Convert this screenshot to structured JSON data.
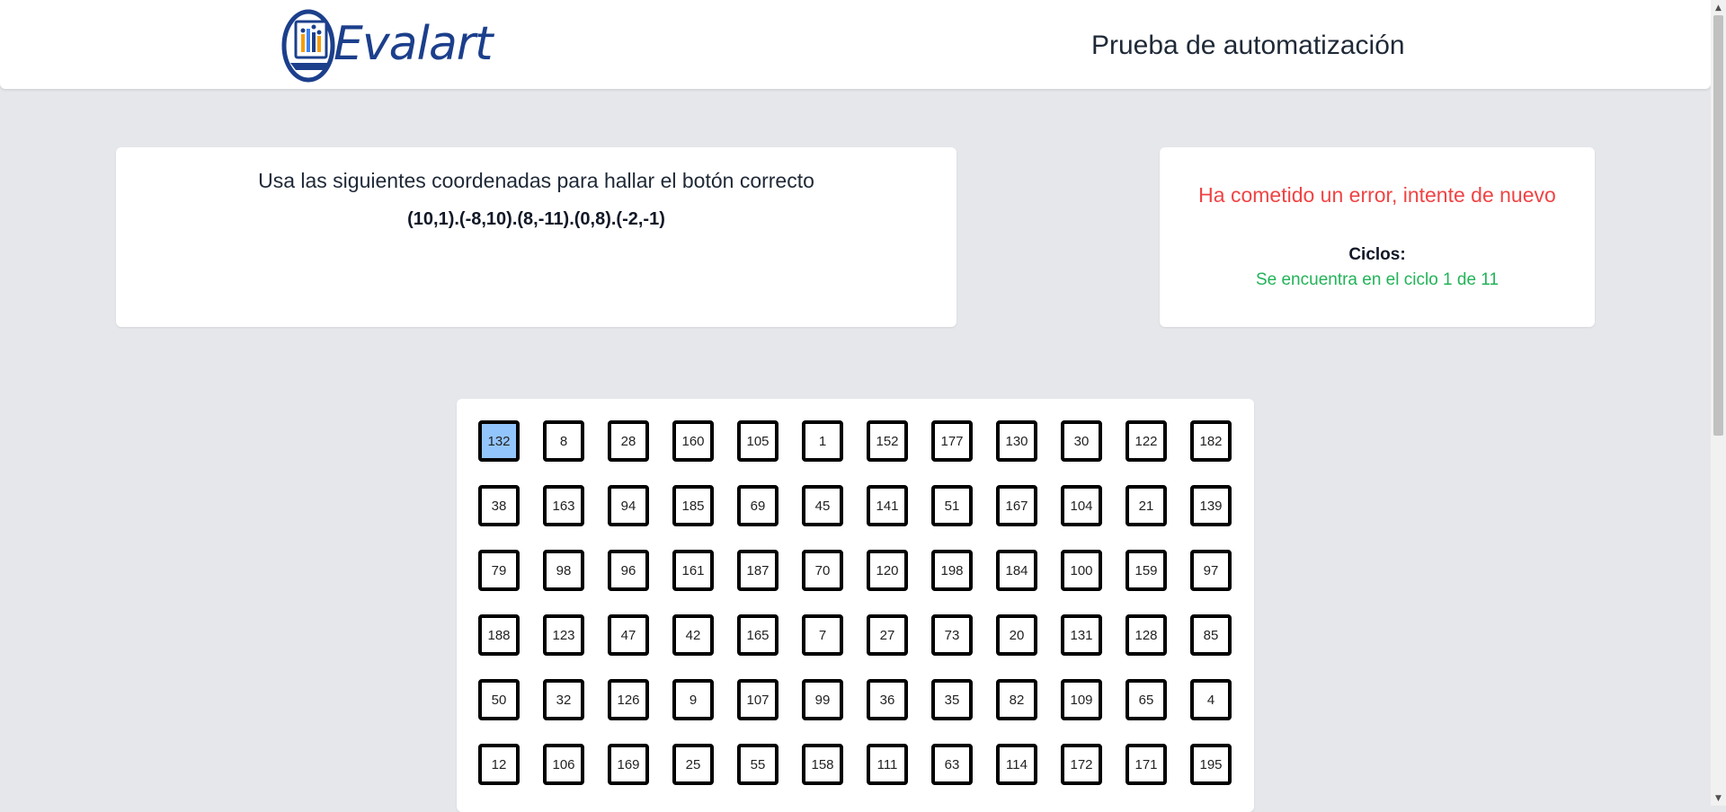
{
  "header": {
    "logo_text": "Evalart",
    "title": "Prueba de automatización"
  },
  "instructions": {
    "title": "Usa las siguientes coordenadas para hallar el botón correcto",
    "coordinates": "(10,1).(-8,10).(8,-11).(0,8).(-2,-1)"
  },
  "status": {
    "error_message": "Ha cometido un error, intente de nuevo",
    "cycles_label": "Ciclos:",
    "cycle_text": "Se encuentra en el ciclo 1 de 11"
  },
  "grid": {
    "selected_value": "132",
    "rows": [
      [
        "132",
        "8",
        "28",
        "160",
        "105",
        "1",
        "152",
        "177",
        "130",
        "30",
        "122",
        "182"
      ],
      [
        "38",
        "163",
        "94",
        "185",
        "69",
        "45",
        "141",
        "51",
        "167",
        "104",
        "21",
        "139"
      ],
      [
        "79",
        "98",
        "96",
        "161",
        "187",
        "70",
        "120",
        "198",
        "184",
        "100",
        "159",
        "97"
      ],
      [
        "188",
        "123",
        "47",
        "42",
        "165",
        "7",
        "27",
        "73",
        "20",
        "131",
        "128",
        "85"
      ],
      [
        "50",
        "32",
        "126",
        "9",
        "107",
        "99",
        "36",
        "35",
        "82",
        "109",
        "65",
        "4"
      ],
      [
        "12",
        "106",
        "169",
        "25",
        "55",
        "158",
        "111",
        "63",
        "114",
        "172",
        "171",
        "195"
      ]
    ]
  },
  "colors": {
    "page_background": "#e5e7eb",
    "error": "#ef4444",
    "cycle": "#22b358",
    "selected_button": "#93c5fd",
    "brand": "#1c3f8c"
  }
}
